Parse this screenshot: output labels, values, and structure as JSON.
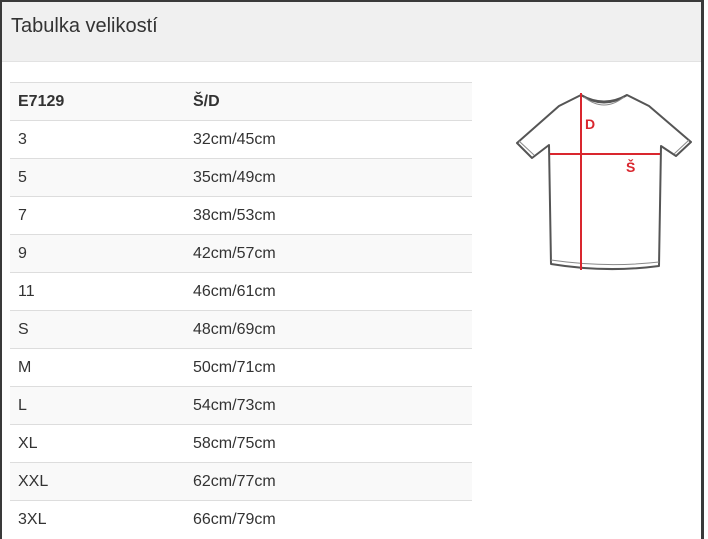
{
  "header": {
    "title": "Tabulka velikostí"
  },
  "table": {
    "headers": [
      "E7129",
      "Š/D"
    ],
    "rows": [
      [
        "3",
        "32cm/45cm"
      ],
      [
        "5",
        "35cm/49cm"
      ],
      [
        "7",
        "38cm/53cm"
      ],
      [
        "9",
        "42cm/57cm"
      ],
      [
        "11",
        "46cm/61cm"
      ],
      [
        "S",
        "48cm/69cm"
      ],
      [
        "M",
        "50cm/71cm"
      ],
      [
        "L",
        "54cm/73cm"
      ],
      [
        "XL",
        "58cm/75cm"
      ],
      [
        "XXL",
        "62cm/77cm"
      ],
      [
        "3XL",
        "66cm/79cm"
      ]
    ]
  },
  "diagram": {
    "length_label": "D",
    "width_label": "Š",
    "measure_color": "#d9262e",
    "icon": "tshirt-icon"
  }
}
